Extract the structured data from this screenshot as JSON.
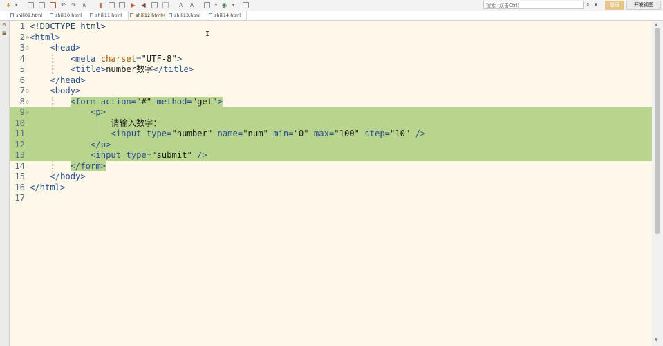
{
  "toolbar": {
    "icons": [
      "new-file-icon",
      "dropdown-icon",
      "save-icon",
      "save-all-icon",
      "undo-icon",
      "redo-icon",
      "format-icon",
      "bookmark-icon",
      "copy-icon",
      "paste-icon",
      "run-icon",
      "prev-icon",
      "next-icon",
      "refresh-icon",
      "browser-icon",
      "font-larger-icon",
      "font-smaller-icon",
      "layout-icon",
      "color-icon",
      "info-icon"
    ],
    "search_placeholder": "搜索 (双击Ctrl)",
    "mode_login": "登录",
    "mode_dev": "开发视图"
  },
  "tabs": [
    {
      "label": "shili09.html",
      "active": false,
      "closable": false
    },
    {
      "label": "shili10.html",
      "active": false,
      "closable": false
    },
    {
      "label": "shili11.html",
      "active": false,
      "closable": false
    },
    {
      "label": "shili12.html",
      "active": true,
      "closable": true
    },
    {
      "label": "shili13.html",
      "active": false,
      "closable": false
    },
    {
      "label": "shili14.html",
      "active": false,
      "closable": false
    }
  ],
  "editor": {
    "line_numbers": [
      "1",
      "2",
      "3",
      "4",
      "5",
      "6",
      "7",
      "8",
      "9",
      "10",
      "11",
      "12",
      "13",
      "14",
      "15",
      "16",
      "17"
    ],
    "lines": [
      {
        "indent": "",
        "parts": [
          [
            "kw",
            "<!DOCTYPE html>"
          ]
        ]
      },
      {
        "indent": "",
        "parts": [
          [
            "tag",
            "<html>"
          ]
        ]
      },
      {
        "indent": "    ",
        "parts": [
          [
            "tag",
            "<head>"
          ]
        ]
      },
      {
        "indent": "        ",
        "parts": [
          [
            "tag",
            "<meta "
          ],
          [
            "attr",
            "charset"
          ],
          [
            "tag",
            "="
          ],
          [
            "val",
            "\"UTF-8\""
          ],
          [
            "tag",
            ">"
          ]
        ]
      },
      {
        "indent": "        ",
        "parts": [
          [
            "tag",
            "<title>"
          ],
          [
            "txt",
            "number数字"
          ],
          [
            "tag",
            "</title>"
          ]
        ]
      },
      {
        "indent": "    ",
        "parts": [
          [
            "tag",
            "</head>"
          ]
        ]
      },
      {
        "indent": "    ",
        "parts": [
          [
            "tag",
            "<body>"
          ]
        ]
      },
      {
        "indent": "        ",
        "parts": [
          [
            "tag",
            "<form action="
          ],
          [
            "val",
            "\"#\""
          ],
          [
            "tag",
            " method="
          ],
          [
            "val",
            "\"get\""
          ],
          [
            "tag",
            ">"
          ]
        ]
      },
      {
        "indent": "            ",
        "parts": [
          [
            "tag",
            "<p>"
          ]
        ]
      },
      {
        "indent": "                ",
        "parts": [
          [
            "txt",
            "请输入数字："
          ]
        ]
      },
      {
        "indent": "                ",
        "parts": [
          [
            "tag",
            "<input type="
          ],
          [
            "val",
            "\"number\""
          ],
          [
            "tag",
            " name="
          ],
          [
            "val",
            "\"num\""
          ],
          [
            "tag",
            " min="
          ],
          [
            "val",
            "\"0\""
          ],
          [
            "tag",
            " max="
          ],
          [
            "val",
            "\"100\""
          ],
          [
            "tag",
            " step="
          ],
          [
            "val",
            "\"10\""
          ],
          [
            "tag",
            " />"
          ]
        ]
      },
      {
        "indent": "            ",
        "parts": [
          [
            "tag",
            "</p>"
          ]
        ]
      },
      {
        "indent": "            ",
        "parts": [
          [
            "tag",
            "<input type="
          ],
          [
            "val",
            "\"submit\""
          ],
          [
            "tag",
            " />"
          ]
        ]
      },
      {
        "indent": "        ",
        "parts": [
          [
            "tag",
            "</form>"
          ]
        ]
      },
      {
        "indent": "    ",
        "parts": [
          [
            "tag",
            "</body>"
          ]
        ]
      },
      {
        "indent": "",
        "parts": [
          [
            "tag",
            "</html>"
          ]
        ]
      },
      {
        "indent": "",
        "parts": []
      }
    ],
    "fold_markers": [
      "",
      "⊖",
      "⊖",
      "",
      "",
      "",
      "⊖",
      "⊖",
      "⊖",
      "",
      "",
      "",
      "",
      "",
      "",
      "",
      ""
    ],
    "selection_start_line": 8,
    "selection_end_line": 14
  }
}
